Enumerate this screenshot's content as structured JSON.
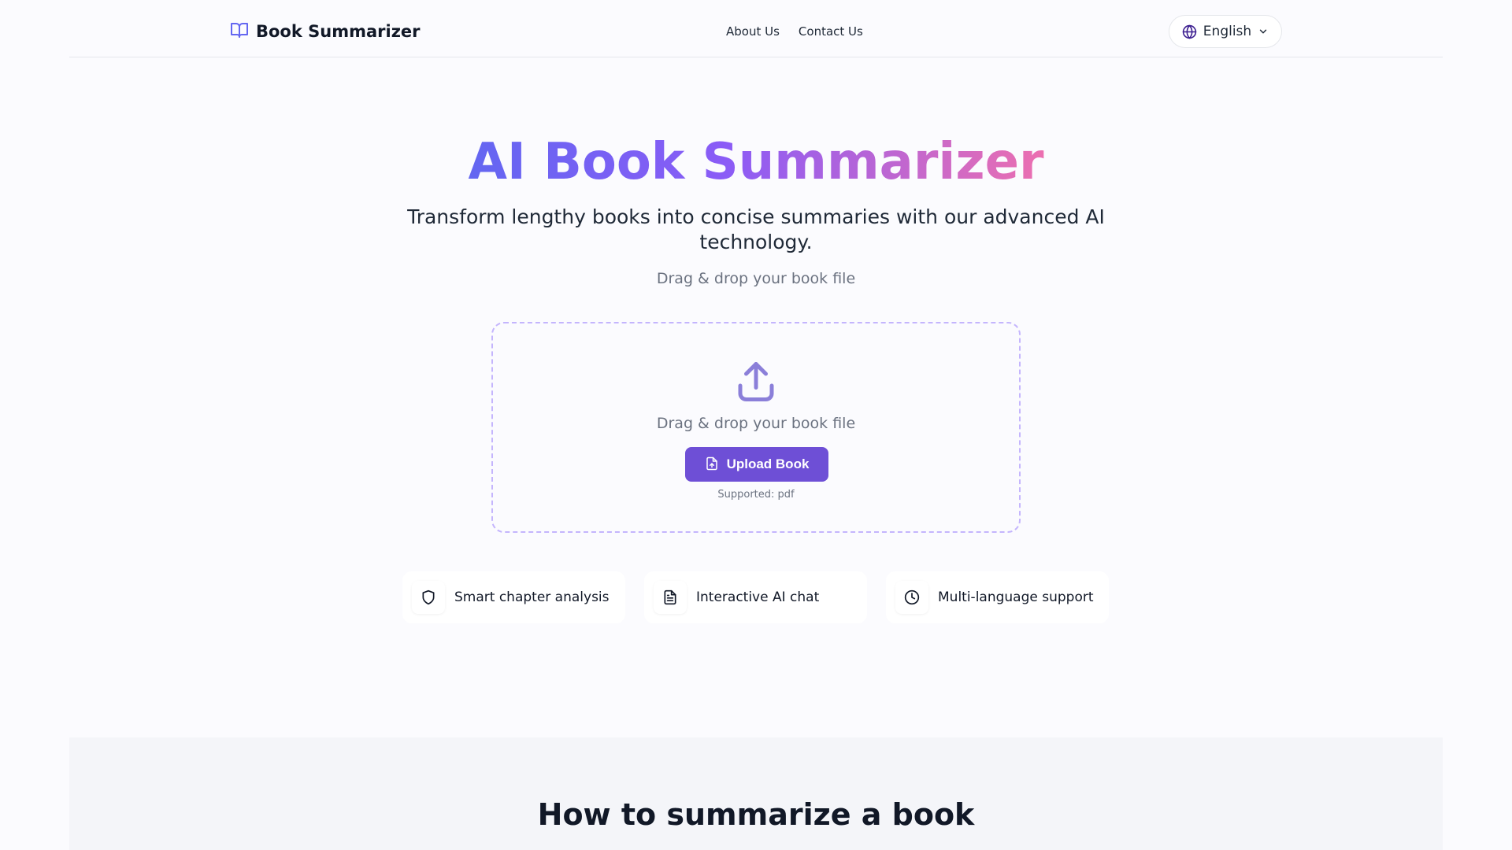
{
  "header": {
    "brand_name": "Book Summarizer",
    "brand_icon": "book-open-icon",
    "nav": [
      {
        "label": "About Us"
      },
      {
        "label": "Contact Us"
      }
    ],
    "language": {
      "selected": "English",
      "icon": "globe-icon"
    }
  },
  "hero": {
    "title": "AI Book Summarizer",
    "subtitle": "Transform lengthy books into concise summaries with our advanced AI technology.",
    "hint": "Drag & drop your book file"
  },
  "dropzone": {
    "text": "Drag & drop your book file",
    "button_label": "Upload Book",
    "supported": "Supported: pdf"
  },
  "features": [
    {
      "icon": "shield-icon",
      "label": "Smart chapter analysis"
    },
    {
      "icon": "document-icon",
      "label": "Interactive AI chat"
    },
    {
      "icon": "clock-icon",
      "label": "Multi-language support"
    }
  ],
  "section": {
    "title": "How to summarize a book"
  },
  "colors": {
    "accent": "#6e4fd6",
    "gradient_start": "#6366f1",
    "gradient_end": "#ec6fb0"
  }
}
